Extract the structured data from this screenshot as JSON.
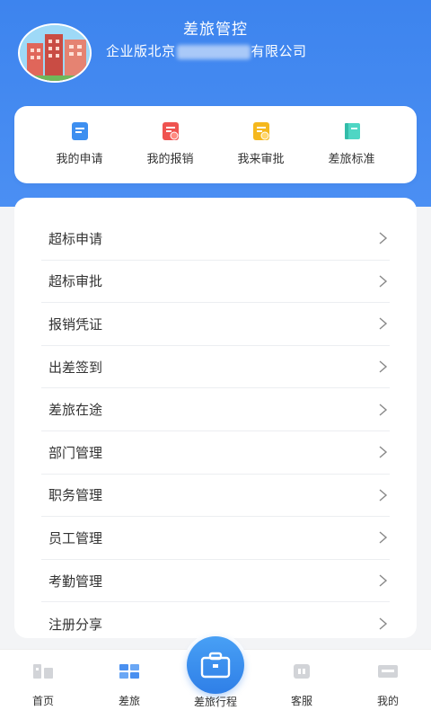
{
  "header": {
    "title": "差旅管控",
    "company_prefix": "企业版北京",
    "company_suffix": "有限公司"
  },
  "quick_actions": [
    {
      "label": "我的申请",
      "icon": "application-doc-icon",
      "color": "#3d8ff0"
    },
    {
      "label": "我的报销",
      "icon": "reimbursement-doc-icon",
      "color": "#ef5350"
    },
    {
      "label": "我来审批",
      "icon": "approval-doc-icon",
      "color": "#f5b81e"
    },
    {
      "label": "差旅标准",
      "icon": "standard-book-icon",
      "color": "#4fd6c4"
    }
  ],
  "menu": {
    "items": [
      {
        "label": "超标申请"
      },
      {
        "label": "超标审批"
      },
      {
        "label": "报销凭证"
      },
      {
        "label": "出差签到"
      },
      {
        "label": "差旅在途"
      },
      {
        "label": "部门管理"
      },
      {
        "label": "职务管理"
      },
      {
        "label": "员工管理"
      },
      {
        "label": "考勤管理"
      },
      {
        "label": "注册分享"
      }
    ]
  },
  "tabbar": {
    "items": [
      {
        "label": "首页",
        "icon": "home-icon"
      },
      {
        "label": "差旅",
        "icon": "travel-grid-icon",
        "active": true
      },
      {
        "label": "差旅行程",
        "icon": "briefcase-icon"
      },
      {
        "label": "客服",
        "icon": "customer-service-icon"
      },
      {
        "label": "我的",
        "icon": "profile-card-icon"
      }
    ]
  },
  "colors": {
    "primary": "#3d84ee",
    "active_tab": "#4a90f0"
  }
}
